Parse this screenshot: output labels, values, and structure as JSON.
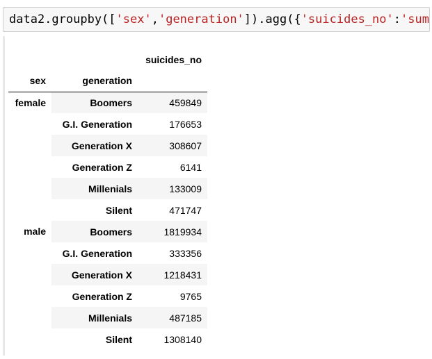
{
  "code_cell": {
    "prefix": "data2.groupby([",
    "str1": "'sex'",
    "comma1": ",",
    "str2": "'generation'",
    "mid": "]).agg({",
    "str3": "'suicides_no'",
    "colon": ":",
    "str4": "'sum'",
    "suffix": "})"
  },
  "table": {
    "value_column": "suicides_no",
    "index_names": [
      "sex",
      "generation"
    ],
    "groups": [
      {
        "sex": "female",
        "rows": [
          {
            "generation": "Boomers",
            "value": "459849"
          },
          {
            "generation": "G.I. Generation",
            "value": "176653"
          },
          {
            "generation": "Generation X",
            "value": "308607"
          },
          {
            "generation": "Generation Z",
            "value": "6141"
          },
          {
            "generation": "Millenials",
            "value": "133009"
          },
          {
            "generation": "Silent",
            "value": "471747"
          }
        ]
      },
      {
        "sex": "male",
        "rows": [
          {
            "generation": "Boomers",
            "value": "1819934"
          },
          {
            "generation": "G.I. Generation",
            "value": "333356"
          },
          {
            "generation": "Generation X",
            "value": "1218431"
          },
          {
            "generation": "Generation Z",
            "value": "9765"
          },
          {
            "generation": "Millenials",
            "value": "487185"
          },
          {
            "generation": "Silent",
            "value": "1308140"
          }
        ]
      }
    ]
  }
}
